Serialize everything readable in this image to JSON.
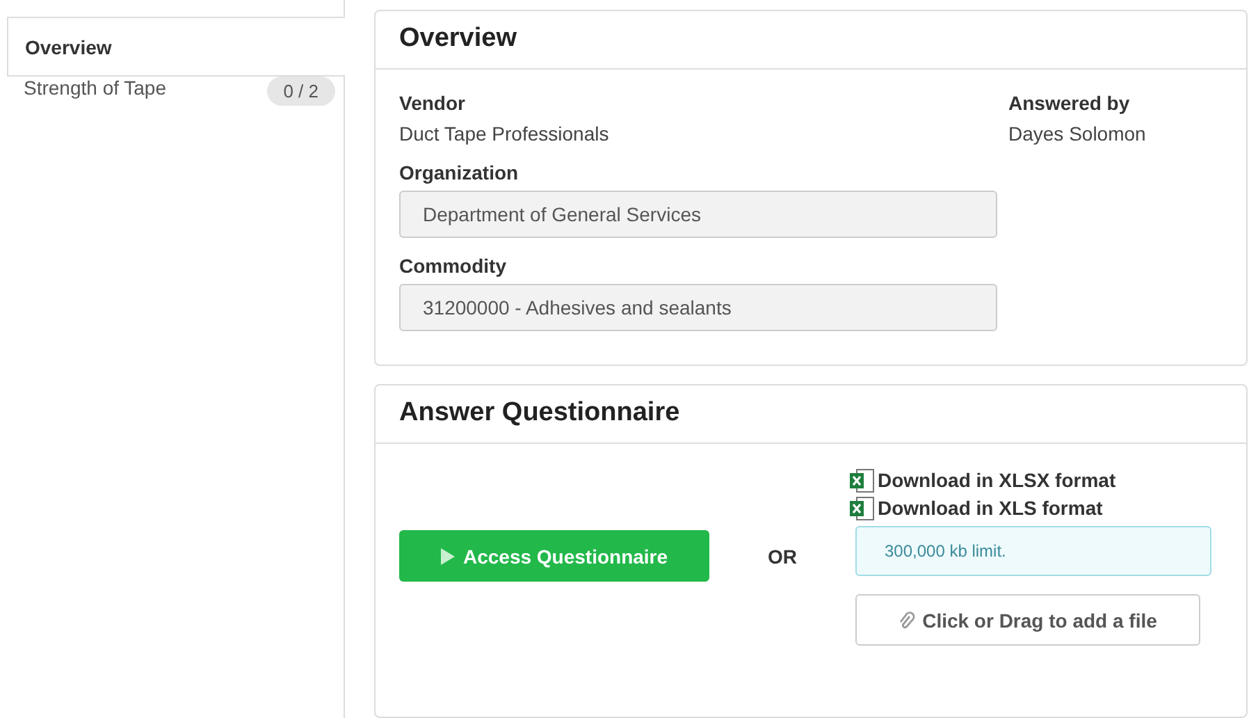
{
  "sidebar": {
    "items": [
      {
        "label": "Overview",
        "selected": true
      },
      {
        "label": "Strength of Tape",
        "selected": false,
        "badge": "0 / 2"
      }
    ]
  },
  "overview": {
    "title": "Overview",
    "vendor": {
      "label": "Vendor",
      "value": "Duct Tape Professionals"
    },
    "answered_by": {
      "label": "Answered by",
      "value": "Dayes Solomon"
    },
    "fields": [
      {
        "label": "Organization",
        "value": "Department of General Services"
      },
      {
        "label": "Commodity",
        "value": "31200000 - Adhesives and sealants"
      }
    ]
  },
  "questionnaire": {
    "title": "Answer Questionnaire",
    "access_button": "Access Questionnaire",
    "separator": "OR",
    "downloads": [
      "Download in XLSX format",
      "Download in XLS format"
    ],
    "limit_note": "300,000 kb limit.",
    "upload_button": "Click or Drag to add a file"
  }
}
